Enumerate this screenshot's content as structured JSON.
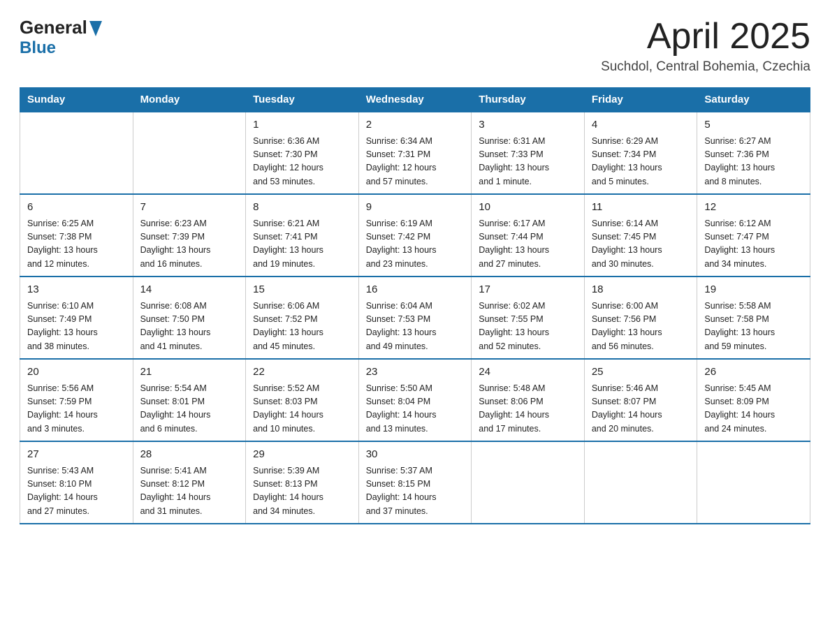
{
  "header": {
    "logo_general": "General",
    "logo_blue": "Blue",
    "title": "April 2025",
    "location": "Suchdol, Central Bohemia, Czechia"
  },
  "calendar": {
    "days_of_week": [
      "Sunday",
      "Monday",
      "Tuesday",
      "Wednesday",
      "Thursday",
      "Friday",
      "Saturday"
    ],
    "weeks": [
      [
        {
          "day": "",
          "info": ""
        },
        {
          "day": "",
          "info": ""
        },
        {
          "day": "1",
          "info": "Sunrise: 6:36 AM\nSunset: 7:30 PM\nDaylight: 12 hours\nand 53 minutes."
        },
        {
          "day": "2",
          "info": "Sunrise: 6:34 AM\nSunset: 7:31 PM\nDaylight: 12 hours\nand 57 minutes."
        },
        {
          "day": "3",
          "info": "Sunrise: 6:31 AM\nSunset: 7:33 PM\nDaylight: 13 hours\nand 1 minute."
        },
        {
          "day": "4",
          "info": "Sunrise: 6:29 AM\nSunset: 7:34 PM\nDaylight: 13 hours\nand 5 minutes."
        },
        {
          "day": "5",
          "info": "Sunrise: 6:27 AM\nSunset: 7:36 PM\nDaylight: 13 hours\nand 8 minutes."
        }
      ],
      [
        {
          "day": "6",
          "info": "Sunrise: 6:25 AM\nSunset: 7:38 PM\nDaylight: 13 hours\nand 12 minutes."
        },
        {
          "day": "7",
          "info": "Sunrise: 6:23 AM\nSunset: 7:39 PM\nDaylight: 13 hours\nand 16 minutes."
        },
        {
          "day": "8",
          "info": "Sunrise: 6:21 AM\nSunset: 7:41 PM\nDaylight: 13 hours\nand 19 minutes."
        },
        {
          "day": "9",
          "info": "Sunrise: 6:19 AM\nSunset: 7:42 PM\nDaylight: 13 hours\nand 23 minutes."
        },
        {
          "day": "10",
          "info": "Sunrise: 6:17 AM\nSunset: 7:44 PM\nDaylight: 13 hours\nand 27 minutes."
        },
        {
          "day": "11",
          "info": "Sunrise: 6:14 AM\nSunset: 7:45 PM\nDaylight: 13 hours\nand 30 minutes."
        },
        {
          "day": "12",
          "info": "Sunrise: 6:12 AM\nSunset: 7:47 PM\nDaylight: 13 hours\nand 34 minutes."
        }
      ],
      [
        {
          "day": "13",
          "info": "Sunrise: 6:10 AM\nSunset: 7:49 PM\nDaylight: 13 hours\nand 38 minutes."
        },
        {
          "day": "14",
          "info": "Sunrise: 6:08 AM\nSunset: 7:50 PM\nDaylight: 13 hours\nand 41 minutes."
        },
        {
          "day": "15",
          "info": "Sunrise: 6:06 AM\nSunset: 7:52 PM\nDaylight: 13 hours\nand 45 minutes."
        },
        {
          "day": "16",
          "info": "Sunrise: 6:04 AM\nSunset: 7:53 PM\nDaylight: 13 hours\nand 49 minutes."
        },
        {
          "day": "17",
          "info": "Sunrise: 6:02 AM\nSunset: 7:55 PM\nDaylight: 13 hours\nand 52 minutes."
        },
        {
          "day": "18",
          "info": "Sunrise: 6:00 AM\nSunset: 7:56 PM\nDaylight: 13 hours\nand 56 minutes."
        },
        {
          "day": "19",
          "info": "Sunrise: 5:58 AM\nSunset: 7:58 PM\nDaylight: 13 hours\nand 59 minutes."
        }
      ],
      [
        {
          "day": "20",
          "info": "Sunrise: 5:56 AM\nSunset: 7:59 PM\nDaylight: 14 hours\nand 3 minutes."
        },
        {
          "day": "21",
          "info": "Sunrise: 5:54 AM\nSunset: 8:01 PM\nDaylight: 14 hours\nand 6 minutes."
        },
        {
          "day": "22",
          "info": "Sunrise: 5:52 AM\nSunset: 8:03 PM\nDaylight: 14 hours\nand 10 minutes."
        },
        {
          "day": "23",
          "info": "Sunrise: 5:50 AM\nSunset: 8:04 PM\nDaylight: 14 hours\nand 13 minutes."
        },
        {
          "day": "24",
          "info": "Sunrise: 5:48 AM\nSunset: 8:06 PM\nDaylight: 14 hours\nand 17 minutes."
        },
        {
          "day": "25",
          "info": "Sunrise: 5:46 AM\nSunset: 8:07 PM\nDaylight: 14 hours\nand 20 minutes."
        },
        {
          "day": "26",
          "info": "Sunrise: 5:45 AM\nSunset: 8:09 PM\nDaylight: 14 hours\nand 24 minutes."
        }
      ],
      [
        {
          "day": "27",
          "info": "Sunrise: 5:43 AM\nSunset: 8:10 PM\nDaylight: 14 hours\nand 27 minutes."
        },
        {
          "day": "28",
          "info": "Sunrise: 5:41 AM\nSunset: 8:12 PM\nDaylight: 14 hours\nand 31 minutes."
        },
        {
          "day": "29",
          "info": "Sunrise: 5:39 AM\nSunset: 8:13 PM\nDaylight: 14 hours\nand 34 minutes."
        },
        {
          "day": "30",
          "info": "Sunrise: 5:37 AM\nSunset: 8:15 PM\nDaylight: 14 hours\nand 37 minutes."
        },
        {
          "day": "",
          "info": ""
        },
        {
          "day": "",
          "info": ""
        },
        {
          "day": "",
          "info": ""
        }
      ]
    ]
  }
}
